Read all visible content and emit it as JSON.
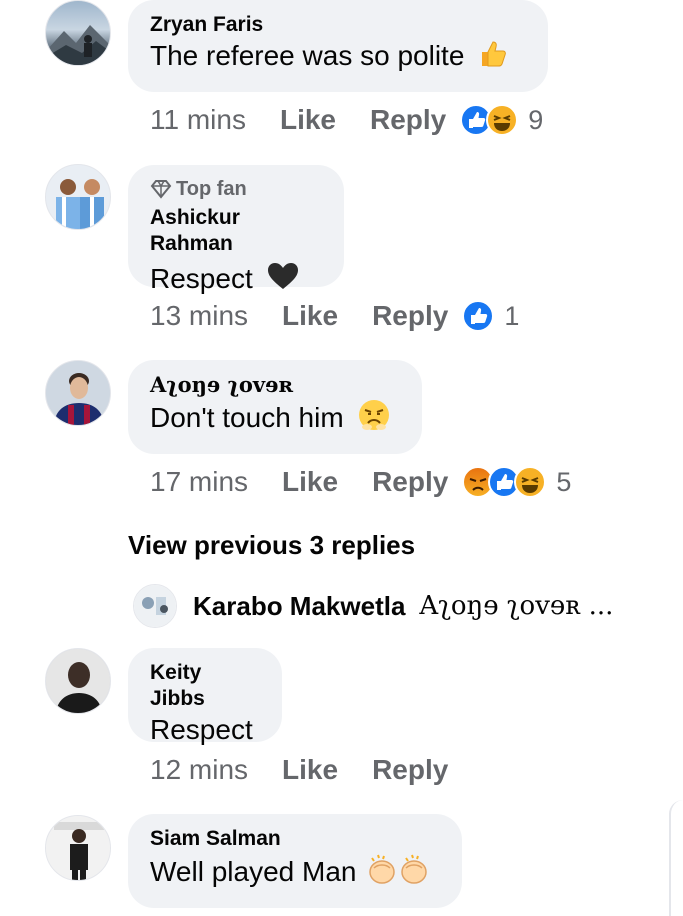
{
  "comments": [
    {
      "author": "Zryan Faris",
      "text": "The referee was so polite",
      "time": "11 mins",
      "like": "Like",
      "reply": "Reply",
      "reaction_count": "9",
      "text_emoji": "thumbs-up-emoji",
      "reactions": [
        "like-reaction-icon",
        "haha-reaction-icon"
      ]
    },
    {
      "badge": "Top fan",
      "author": "Ashickur Rahman",
      "text": "Respect",
      "time": "13 mins",
      "like": "Like",
      "reply": "Reply",
      "reaction_count": "1",
      "text_emoji": "black-heart-emoji",
      "reactions": [
        "like-reaction-icon"
      ]
    },
    {
      "author": "Aʅoŋɘ ʅovɘʀ",
      "text": "Don't touch him",
      "time": "17 mins",
      "like": "Like",
      "reply": "Reply",
      "reaction_count": "5",
      "text_emoji": "frowning-face-emoji",
      "reactions": [
        "angry-reaction-icon",
        "like-reaction-icon",
        "haha-reaction-icon"
      ]
    },
    {
      "author": "Keity Jibbs",
      "text": "Respect",
      "time": "12 mins",
      "like": "Like",
      "reply": "Reply"
    },
    {
      "author": "Siam Salman",
      "text": "Well played Man",
      "text_emoji": "clapping-hands-emoji"
    }
  ],
  "view_previous": "View previous 3 replies",
  "reply_preview": {
    "name": "Karabo Makwetla",
    "snippet": "Aʅoŋɘ ʅovɘʀ ..."
  },
  "colors": {
    "bubble": "#f0f2f5",
    "meta": "#65676b",
    "like_blue": "#1877f2",
    "haha_yellow": "#f7b125",
    "angry_orange": "#e9710f"
  }
}
